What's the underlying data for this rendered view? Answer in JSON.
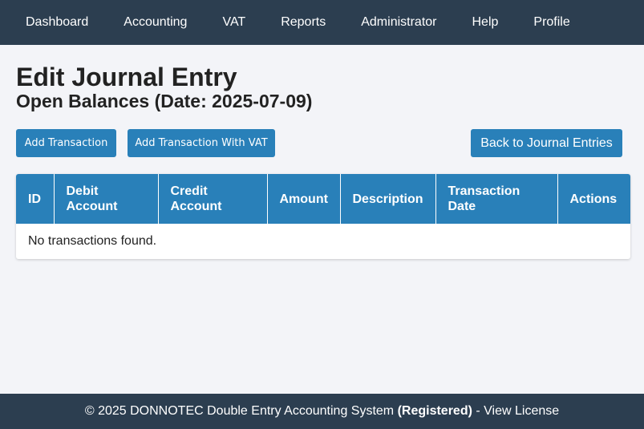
{
  "nav": {
    "items": [
      {
        "label": "Dashboard"
      },
      {
        "label": "Accounting"
      },
      {
        "label": "VAT"
      },
      {
        "label": "Reports"
      },
      {
        "label": "Administrator"
      },
      {
        "label": "Help"
      },
      {
        "label": "Profile"
      }
    ]
  },
  "page": {
    "title": "Edit Journal Entry",
    "subtitle": "Open Balances (Date: 2025-07-09)"
  },
  "toolbar": {
    "add_transaction": "Add Transaction",
    "add_transaction_vat": "Add Transaction With VAT",
    "back": "Back to Journal Entries"
  },
  "table": {
    "columns": [
      "ID",
      "Debit Account",
      "Credit Account",
      "Amount",
      "Description",
      "Transaction Date",
      "Actions"
    ],
    "empty_message": "No transactions found."
  },
  "footer": {
    "copyright": "© 2025 DONNOTEC Double Entry Accounting System",
    "registered": "(Registered)",
    "separator": "-",
    "license_link": "View License"
  },
  "colors": {
    "navbar": "#2c3e50",
    "accent": "#2980b9",
    "background": "#f3f4f8"
  }
}
